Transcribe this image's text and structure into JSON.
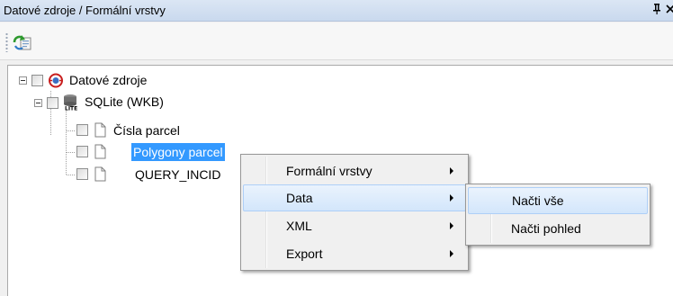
{
  "window": {
    "title": "Datové zdroje / Formální vrstvy",
    "pin_glyph": "ᵽ",
    "close_glyph": "×"
  },
  "toolbar": {
    "buttons": [
      {
        "icon": "refresh-datasource-icon"
      }
    ]
  },
  "tree": {
    "root": {
      "label": "Datové zdroje",
      "icon": "datasource-root-icon"
    },
    "database": {
      "label": "SQLite (WKB)",
      "icon": "sqlite-db-icon"
    },
    "layers": [
      {
        "label": "Čísla parcel",
        "icon": "document-icon",
        "selected": false
      },
      {
        "label": "Polygony parcel",
        "icon": "document-icon",
        "selected": true
      },
      {
        "label": "QUERY_INCID",
        "icon": "document-icon",
        "selected": false
      }
    ]
  },
  "context_menu": {
    "items": [
      {
        "label": "Formální vrstvy",
        "has_submenu": true,
        "highlighted": false
      },
      {
        "label": "Data",
        "has_submenu": true,
        "highlighted": true
      },
      {
        "label": "XML",
        "has_submenu": true,
        "highlighted": false
      },
      {
        "label": "Export",
        "has_submenu": true,
        "highlighted": false
      }
    ]
  },
  "submenu": {
    "items": [
      {
        "label": "Načti vše",
        "highlighted": true
      },
      {
        "label": "Načti pohled",
        "highlighted": false
      }
    ]
  },
  "colors": {
    "selection": "#3399ff",
    "menu_highlight": "#d3e6fb",
    "titlebar": "#c9d9ee"
  }
}
